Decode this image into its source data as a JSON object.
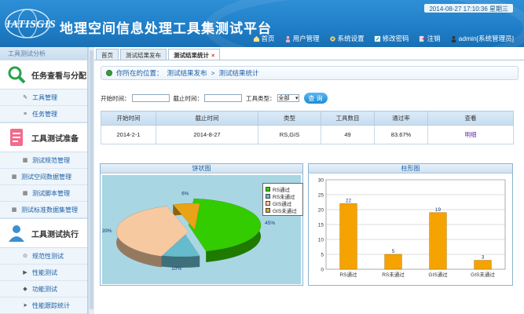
{
  "header": {
    "logo_text": "IATISGIS",
    "title": "地理空间信息处理工具集测试平台",
    "clock": "2014-08-27 17:10:36 星期三",
    "nav": [
      {
        "label": "首页",
        "icon": "home-icon"
      },
      {
        "label": "用户管理",
        "icon": "users-icon"
      },
      {
        "label": "系统设置",
        "icon": "gear-icon"
      },
      {
        "label": "修改密码",
        "icon": "edit-icon"
      },
      {
        "label": "注销",
        "icon": "logout-icon"
      },
      {
        "label": "admin[系统管理员]",
        "icon": "user-icon"
      }
    ]
  },
  "sidebar": {
    "top_text": "工具测试分析",
    "groups": [
      {
        "label": "任务查看与分配",
        "icon": "magnifier-icon",
        "items": [
          {
            "label": "工具管理"
          },
          {
            "label": "任务管理"
          }
        ]
      },
      {
        "label": "工具测试准备",
        "icon": "document-icon",
        "items": [
          {
            "label": "测试规范管理"
          },
          {
            "label": "测试空间数据管理"
          },
          {
            "label": "测试脚本管理"
          },
          {
            "label": "测试标准数据集管理"
          }
        ]
      },
      {
        "label": "工具测试执行",
        "icon": "person-icon",
        "items": [
          {
            "label": "规范性测试"
          },
          {
            "label": "性能测试"
          },
          {
            "label": "功能测试"
          },
          {
            "label": "性能跟踪统计"
          }
        ]
      }
    ]
  },
  "tabs": [
    {
      "label": "首页",
      "closable": false,
      "active": false
    },
    {
      "label": "测试结果发布",
      "closable": false,
      "active": false
    },
    {
      "label": "测试结果统计",
      "closable": true,
      "active": true
    }
  ],
  "breadcrumb": {
    "prefix": "你所在的位置：",
    "path1": "测试结果发布",
    "sep": ">",
    "path2": "测试结果统计"
  },
  "filter": {
    "start_label": "开始时间：",
    "end_label": "截止时间：",
    "type_label": "工具类型：",
    "type_value": "全部",
    "query_label": "查 询"
  },
  "table": {
    "headers": [
      "开始时间",
      "截止时间",
      "类型",
      "工具数目",
      "通过率",
      "查看"
    ],
    "rows": [
      [
        "2014-2-1",
        "2014-8-27",
        "RS,GIS",
        "49",
        "83.67%",
        "明细"
      ]
    ]
  },
  "pie_panel": {
    "title": "饼状图"
  },
  "bar_panel": {
    "title": "柱形图"
  },
  "chart_data": [
    {
      "type": "pie",
      "title": "饼状图",
      "labels": [
        "RS通过",
        "RS未通过",
        "GIS通过",
        "GIS未通过"
      ],
      "values": [
        45,
        10,
        39,
        6
      ],
      "value_labels": [
        "45%",
        "10%",
        "39%",
        "6%"
      ],
      "colors": [
        "#33cc00",
        "#66bbcc",
        "#f7c9a1",
        "#e8a317"
      ],
      "legend": "top-right",
      "three_d": true
    },
    {
      "type": "bar",
      "title": "柱形图",
      "categories": [
        "RS通过",
        "RS未通过",
        "GIS通过",
        "GIS未通过"
      ],
      "values": [
        22,
        5,
        19,
        3
      ],
      "ylim": [
        0,
        30
      ],
      "yticks": [
        0,
        5,
        10,
        15,
        20,
        25,
        30
      ],
      "color": "#f5a300",
      "grid": true
    }
  ]
}
